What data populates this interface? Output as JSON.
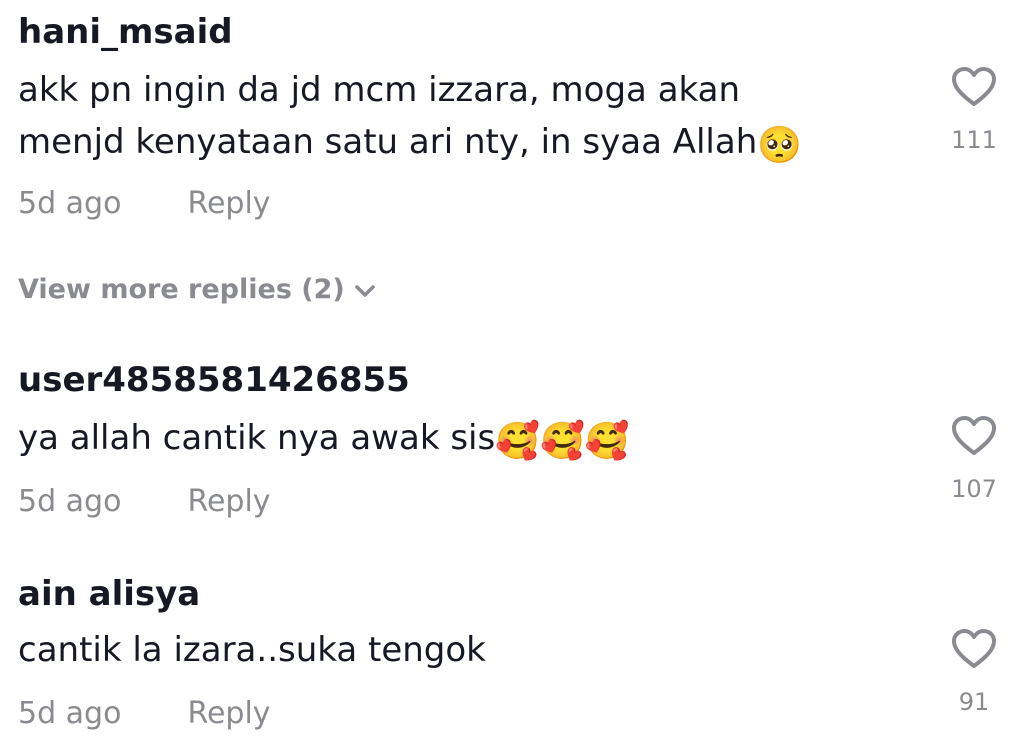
{
  "colors": {
    "text_primary": "#161823",
    "text_secondary": "#8a8b91",
    "background": "#ffffff"
  },
  "comments": [
    {
      "username": "hani_msaid",
      "text_line1": "akk pn ingin da jd mcm izzara, moga akan",
      "text_line2": "menjd kenyataan satu ari nty, in syaa Allah",
      "emoji": "🥺",
      "time": "5d ago",
      "reply_label": "Reply",
      "likes": "111",
      "like_icon": "heart-outline-icon"
    },
    {
      "username": "user4858581426855",
      "text_line1": "ya allah cantik nya awak sis",
      "emoji": "🥰🥰🥰",
      "time": "5d ago",
      "reply_label": "Reply",
      "likes": "107",
      "like_icon": "heart-outline-icon"
    },
    {
      "username": "ain alisya",
      "text_line1": "cantik la izara..suka tengok",
      "time": "5d ago",
      "reply_label": "Reply",
      "likes": "91",
      "like_icon": "heart-outline-icon"
    }
  ],
  "view_more_replies": {
    "label": "View more replies (2)",
    "icon": "chevron-down-icon"
  }
}
